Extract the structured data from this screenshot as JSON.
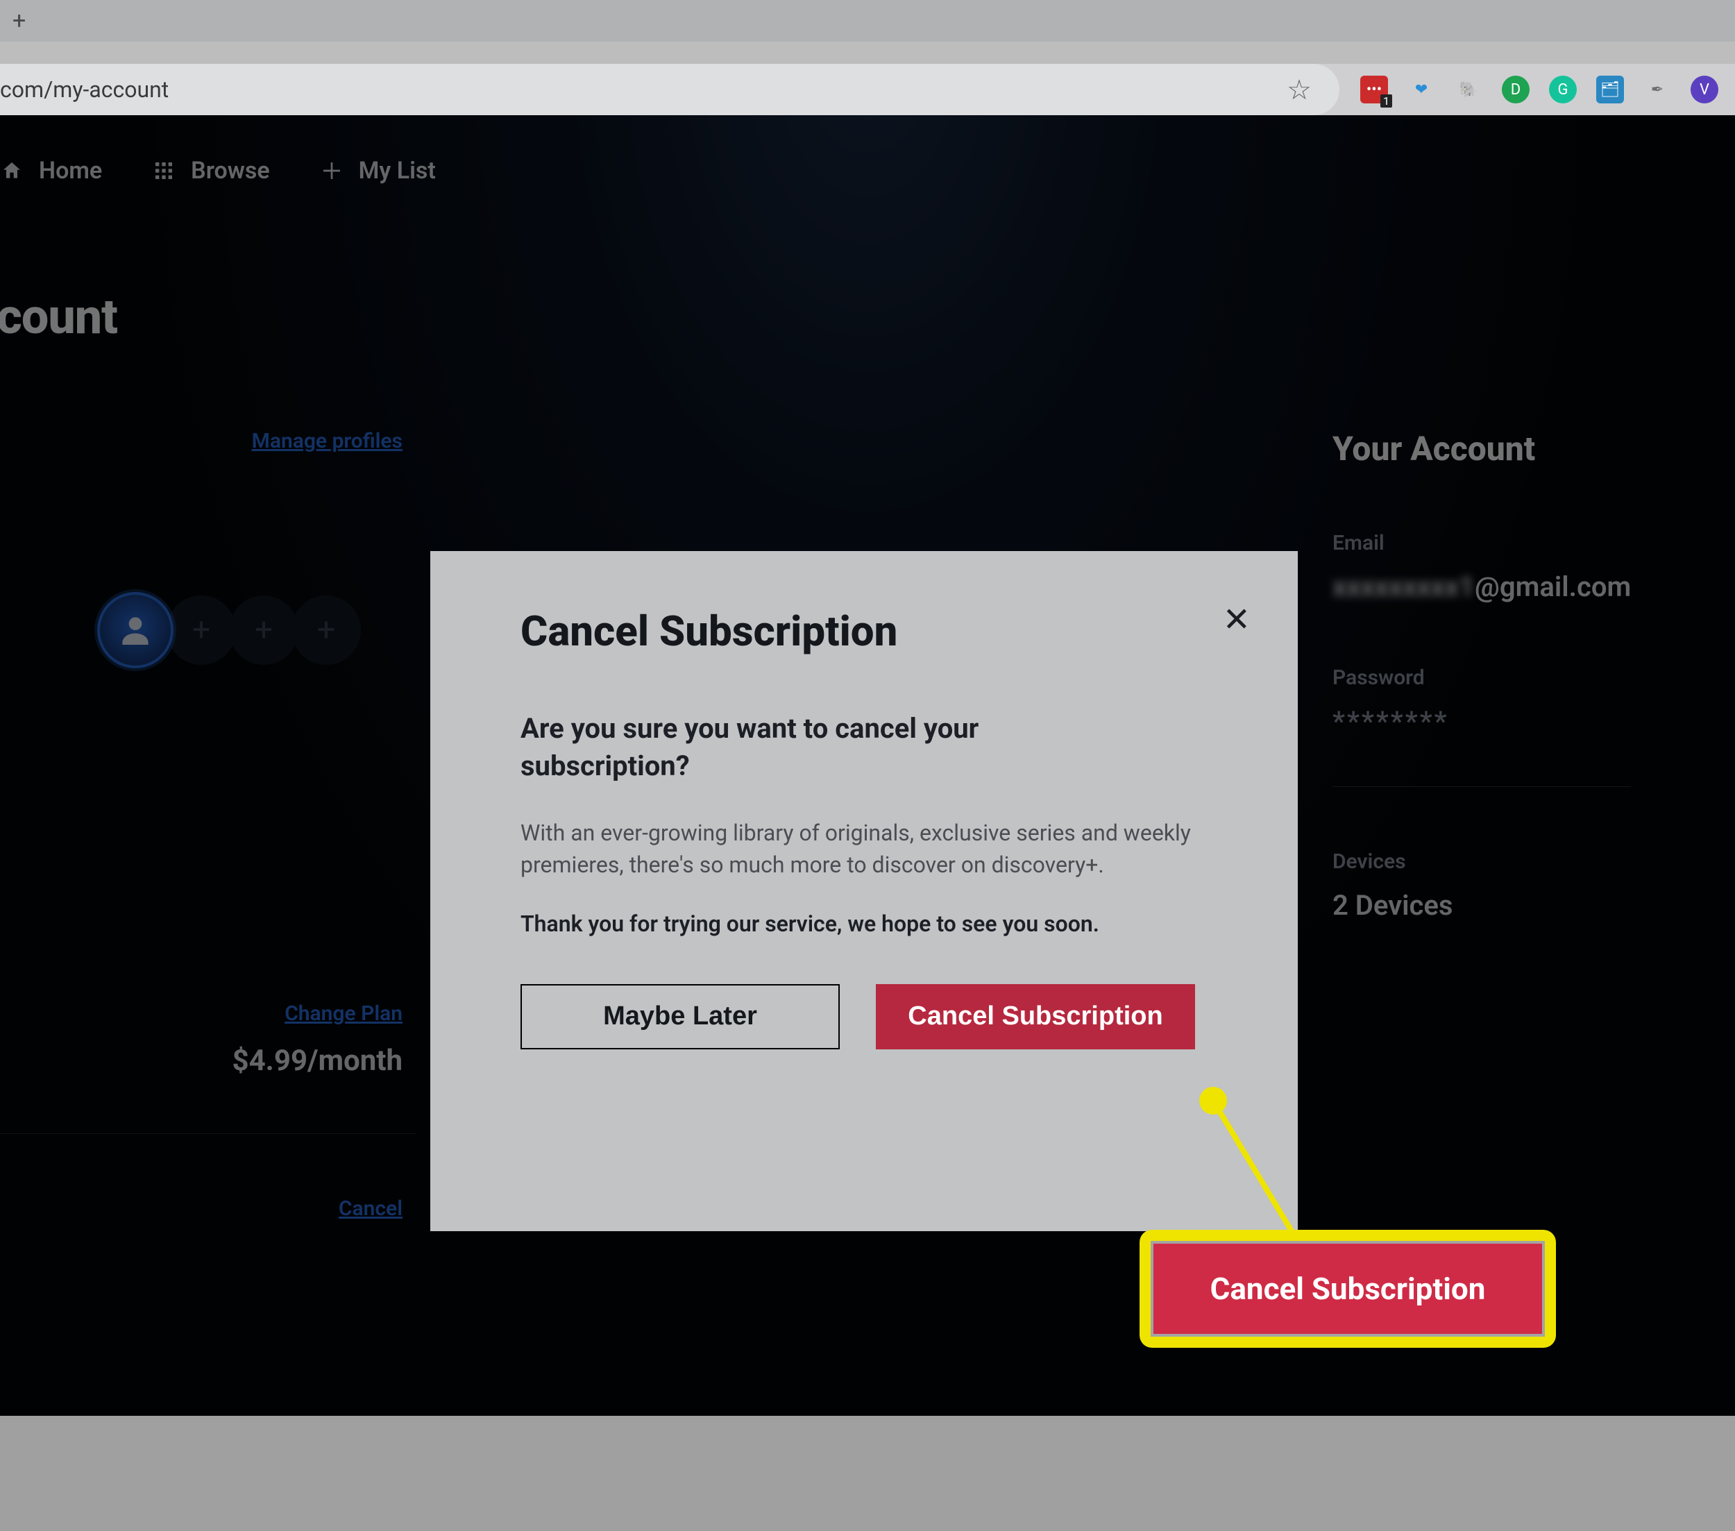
{
  "browser": {
    "url": "com/my-account",
    "star_icon": "★",
    "extensions": [
      {
        "name": "lastpass-icon",
        "bg": "#cc2b2b",
        "shape": "square",
        "glyph": "•••",
        "badge": "1"
      },
      {
        "name": "blue-drop-icon",
        "bg": "transparent",
        "glyph": "❤",
        "color": "#2a8fd8"
      },
      {
        "name": "evernote-icon",
        "bg": "transparent",
        "glyph": "🐘",
        "color": "#2dbd3a"
      },
      {
        "name": "d-circle-icon",
        "bg": "#1da352",
        "glyph": "D"
      },
      {
        "name": "grammarly-icon",
        "bg": "#15c39a",
        "glyph": "G"
      },
      {
        "name": "folder-icon",
        "bg": "#2a87c2",
        "shape": "square",
        "glyph": "🗂"
      },
      {
        "name": "feather-icon",
        "bg": "transparent",
        "glyph": "✒",
        "color": "#6f6f6f"
      },
      {
        "name": "v-circle-icon",
        "bg": "#5b3fc1",
        "glyph": "V"
      }
    ]
  },
  "nav": {
    "home": "Home",
    "browse": "Browse",
    "mylist": "My List"
  },
  "page": {
    "title": "Account",
    "title_visible": "ccount"
  },
  "profiles": {
    "manage_link": "Manage profiles"
  },
  "plan": {
    "change_link": "Change Plan",
    "price": "$4.99/month",
    "cancel_link": "Cancel"
  },
  "account_panel": {
    "title": "Your Account",
    "email_label": "Email",
    "email_hidden_part": "xxxxxxxxx1",
    "email_domain": "@gmail.com",
    "password_label": "Password",
    "password_mask": "********",
    "devices_label": "Devices",
    "devices_value": "2 Devices"
  },
  "modal": {
    "title": "Cancel Subscription",
    "question": "Are you sure you want to cancel your subscription?",
    "body": "With an ever-growing library of originals, exclusive series and weekly premieres, there's so much more to discover on discovery+.",
    "thanks": "Thank you for trying our service, we hope to see you soon.",
    "maybe_later": "Maybe Later",
    "cancel_btn": "Cancel Subscription"
  },
  "callout": {
    "label": "Cancel Subscription"
  }
}
